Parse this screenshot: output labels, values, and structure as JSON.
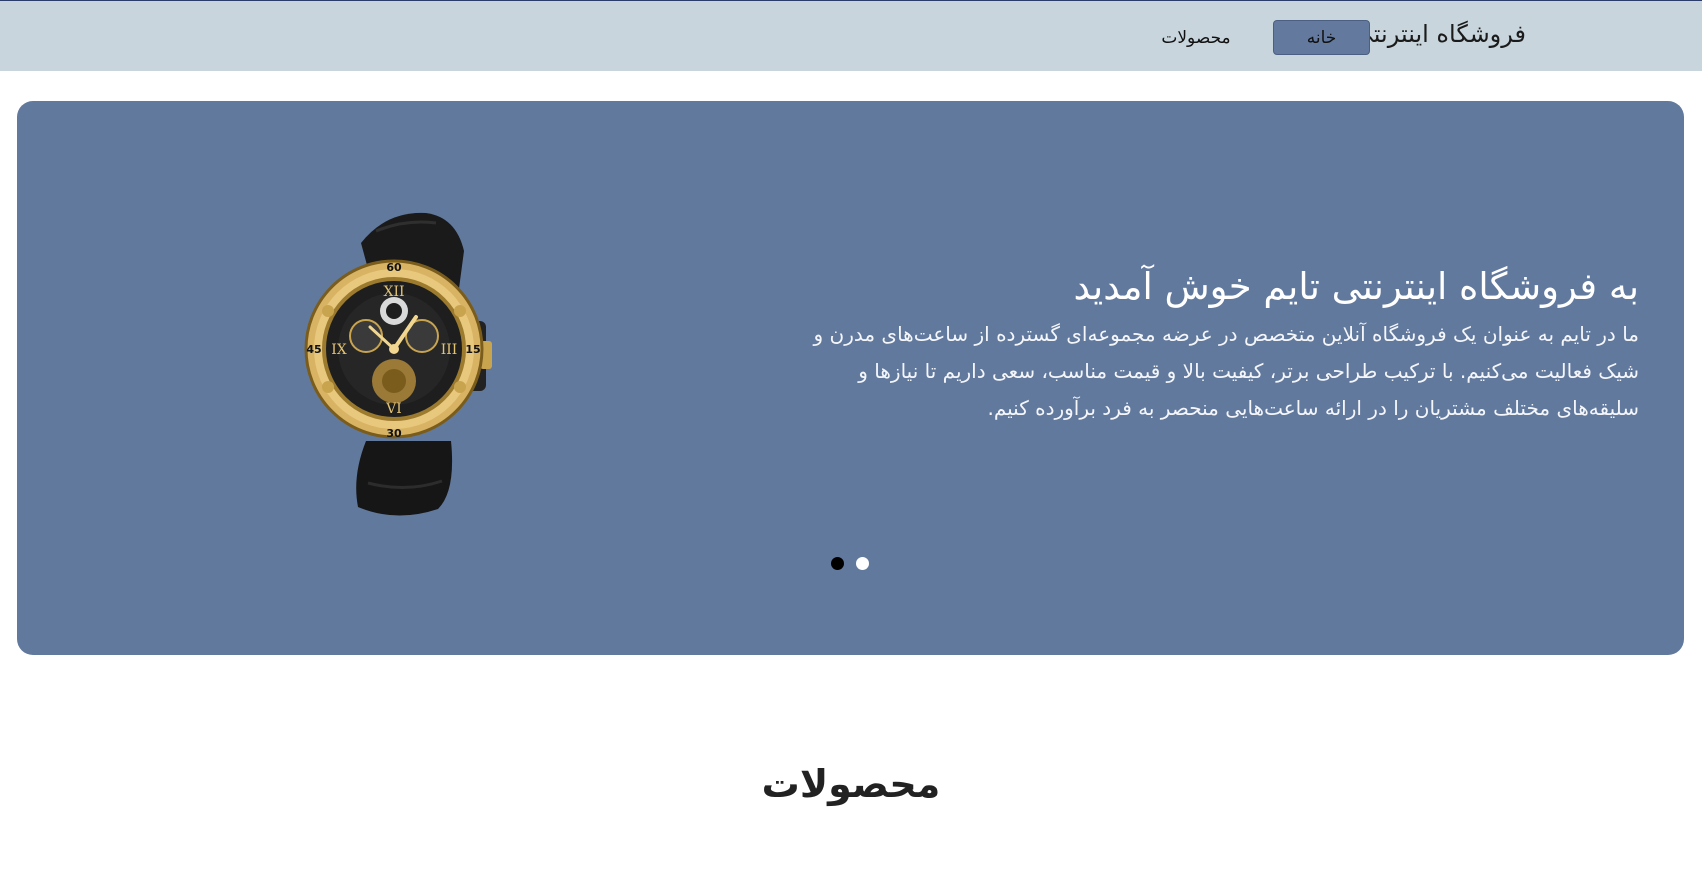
{
  "header": {
    "brand": "فروشگاه اینترنتی تایم",
    "nav": [
      {
        "label": "خانه",
        "active": true
      },
      {
        "label": "محصولات",
        "active": false
      }
    ]
  },
  "hero": {
    "title": "به فروشگاه اینترنتی تایم خوش آمدید",
    "description": "ما در تایم به عنوان یک فروشگاه آنلاین متخصص در عرضه مجموعه‌ای گسترده از ساعت‌های مدرن و شیک فعالیت می‌کنیم. با ترکیب طراحی برتر، کیفیت بالا و قیمت مناسب، سعی داریم تا نیازها و سلیقه‌های مختلف مشتریان را در ارائه ساعت‌هایی منحصر به فرد برآورده کنیم.",
    "image": "wristwatch-gold-black",
    "slide_count": 2,
    "active_slide": 1
  },
  "products_section": {
    "title": "محصولات"
  },
  "colors": {
    "header_bg": "#c8d5dc",
    "accent": "#62799e",
    "active_dot": "#000000",
    "inactive_dot": "#ffffff"
  }
}
